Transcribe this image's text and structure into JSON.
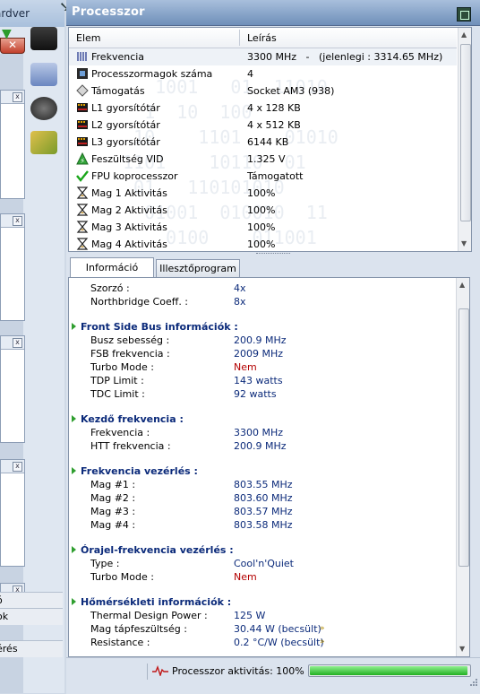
{
  "left_window": {
    "title_fragment": "ardver",
    "close_label": "✕",
    "panel_close": "x",
    "footer_items": [
      "ó",
      "ok",
      "érés"
    ]
  },
  "window": {
    "title": "Processzor"
  },
  "list": {
    "headers": {
      "name": "Elem",
      "value": "Leírás"
    },
    "rows": [
      {
        "icon": "frequency-icon",
        "name": "Frekvencia",
        "value": "3300 MHz   -   (jelenlegi : 3314.65 MHz)"
      },
      {
        "icon": "cpu-icon",
        "name": "Processzormagok száma",
        "value": "4"
      },
      {
        "icon": "socket-icon",
        "name": "Támogatás",
        "value": "Socket AM3 (938)"
      },
      {
        "icon": "cache-icon",
        "name": "L1 gyorsítótár",
        "value": "4 x 128 KB"
      },
      {
        "icon": "cache-icon",
        "name": "L2 gyorsítótár",
        "value": "4 x 512 KB"
      },
      {
        "icon": "cache-icon",
        "name": "L3 gyorsítótár",
        "value": "6144 KB"
      },
      {
        "icon": "voltage-icon",
        "name": "Feszültség VID",
        "value": "1.325 V"
      },
      {
        "icon": "checkmark-icon",
        "name": "FPU koprocesszor",
        "value": "Támogatott"
      },
      {
        "icon": "hourglass-icon",
        "name": "Mag 1 Aktivitás",
        "value": "100%"
      },
      {
        "icon": "hourglass-icon",
        "name": "Mag 2 Aktivitás",
        "value": "100%"
      },
      {
        "icon": "hourglass-icon",
        "name": "Mag 3 Aktivitás",
        "value": "100%"
      },
      {
        "icon": "hourglass-icon",
        "name": "Mag 4 Aktivitás",
        "value": "100%"
      }
    ]
  },
  "tabs": [
    {
      "label": "Információ",
      "active": true
    },
    {
      "label": "Illesztőprogram",
      "active": false
    }
  ],
  "info": {
    "top_items": [
      {
        "label": "Szorzó :",
        "value": "4x"
      },
      {
        "label": "Northbridge Coeff. :",
        "value": "8x"
      }
    ],
    "sections": [
      {
        "title": "Front Side Bus információk :",
        "items": [
          {
            "label": "Busz sebesség :",
            "value": "200.9 MHz"
          },
          {
            "label": "FSB frekvencia :",
            "value": "2009 MHz"
          },
          {
            "label": "Turbo Mode :",
            "value": "Nem",
            "color": "#b30000"
          },
          {
            "label": "TDP Limit :",
            "value": "143 watts"
          },
          {
            "label": "TDC Limit :",
            "value": "92 watts"
          }
        ]
      },
      {
        "title": "Kezdő frekvencia :",
        "items": [
          {
            "label": "Frekvencia :",
            "value": "3300 MHz"
          },
          {
            "label": "HTT frekvencia :",
            "value": "200.9 MHz"
          }
        ]
      },
      {
        "title": "Frekvencia vezérlés :",
        "items": [
          {
            "label": "Mag #1 :",
            "value": "803.55 MHz"
          },
          {
            "label": "Mag #2 :",
            "value": "803.60 MHz"
          },
          {
            "label": "Mag #3 :",
            "value": "803.57 MHz"
          },
          {
            "label": "Mag #4 :",
            "value": "803.58 MHz"
          }
        ]
      },
      {
        "title": "Órajel-frekvencia vezérlés :",
        "items": [
          {
            "label": "Type :",
            "value": "Cool'n'Quiet"
          },
          {
            "label": "Turbo Mode :",
            "value": "Nem",
            "color": "#b30000"
          }
        ]
      },
      {
        "title": "Hőmérsékleti információk :",
        "items": [
          {
            "label": "Thermal Design Power :",
            "value": "125 W"
          },
          {
            "label": "Mag tápfeszültség :",
            "value": "30.44 W (becsült)",
            "more": "»"
          },
          {
            "label": "Resistance :",
            "value": "0.2 °C/W (becsült)",
            "more": "»"
          }
        ]
      }
    ]
  },
  "status": {
    "text": "Processzor aktivitás: 100%",
    "progress": 1.0
  },
  "colors": {
    "title_bar": "#6f8fb9",
    "section_title": "#0b2a7a",
    "negative_value": "#b30000",
    "progress_green": "#22b022"
  }
}
